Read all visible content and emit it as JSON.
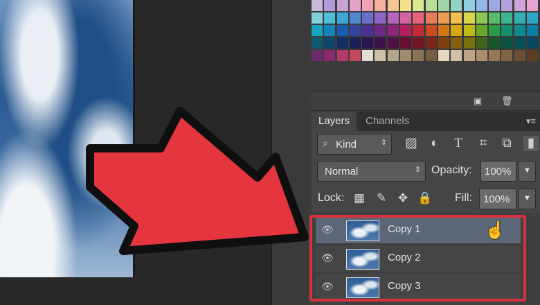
{
  "swatch_colors": [
    [
      "#c8b9d9",
      "#b19cd9",
      "#c9a3d6",
      "#e6a2c8",
      "#f2a0b4",
      "#f5b19b",
      "#f6c690",
      "#f5e08c",
      "#d9e88f",
      "#b8dd96",
      "#9fd5a6",
      "#93d3c1",
      "#90cde0",
      "#92b9e5",
      "#9ea6e3",
      "#b5a2dd",
      "#cfa3d8",
      "#e6a3cf"
    ],
    [
      "#7fd0d8",
      "#4cbfd6",
      "#3da7d8",
      "#4d86d1",
      "#6a6fcb",
      "#8d66c6",
      "#b565bd",
      "#d764a0",
      "#e8647a",
      "#ec7a5d",
      "#ee9a52",
      "#efc04d",
      "#d4d54a",
      "#8fc755",
      "#56bb6b",
      "#3ab58f",
      "#33b1b2",
      "#2fa6c8"
    ],
    [
      "#19a5c0",
      "#1284b9",
      "#1a5fad",
      "#3343a0",
      "#4b2f96",
      "#6c2789",
      "#91257a",
      "#b21f5b",
      "#c62a34",
      "#cc4a22",
      "#d27419",
      "#d9a814",
      "#bdbb14",
      "#6aa82c",
      "#2b9b45",
      "#138f6c",
      "#0c8c8f",
      "#0a7ea6"
    ],
    [
      "#0f5a73",
      "#0c456e",
      "#102e66",
      "#1a1f5a",
      "#2a1552",
      "#3c104b",
      "#520f43",
      "#670d33",
      "#741425",
      "#7a2618",
      "#7f3f11",
      "#85600c",
      "#75710c",
      "#3e6419",
      "#17582a",
      "#0a5240",
      "#075056",
      "#064862"
    ],
    [
      "#6a2b6e",
      "#8c2a6e",
      "#b23a6a",
      "#c24a5a",
      "#e4ddd1",
      "#cdbfa9",
      "#b7a58a",
      "#a18b6d",
      "#8a7254",
      "#765d42",
      "#e6d7c3",
      "#d3bfa3",
      "#bea584",
      "#ab8e6a",
      "#957854",
      "#826342",
      "#6d5033",
      "#5a3f26"
    ]
  ],
  "tabs": {
    "layers": "Layers",
    "channels": "Channels"
  },
  "kind_filter": {
    "value": "Kind"
  },
  "blend_mode": {
    "value": "Normal"
  },
  "opacity": {
    "label": "Opacity:",
    "value": "100%"
  },
  "lock": {
    "label": "Lock:"
  },
  "fill": {
    "label": "Fill:",
    "value": "100%"
  },
  "layers": [
    {
      "name": "Copy 1",
      "selected": true
    },
    {
      "name": "Copy 2",
      "selected": false
    },
    {
      "name": "Copy 3",
      "selected": false
    }
  ],
  "accent_colors": {
    "arrow": "#e5353f",
    "highlight": "#d7313c"
  }
}
